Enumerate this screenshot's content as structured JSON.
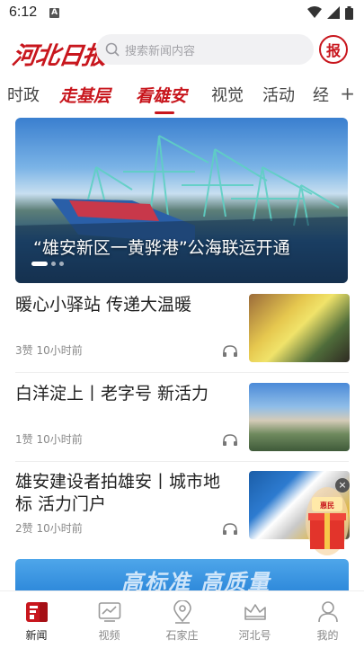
{
  "status_bar": {
    "time": "6:12",
    "notification_icon": "A"
  },
  "header": {
    "logo_text": "河北日报",
    "search_placeholder": "搜索新闻内容",
    "paper_button_label": "报"
  },
  "tabs": [
    {
      "label": "时政",
      "style": "plain"
    },
    {
      "label": "走基层",
      "style": "art"
    },
    {
      "label": "看雄安",
      "style": "art",
      "active": true
    },
    {
      "label": "视觉",
      "style": "plain"
    },
    {
      "label": "活动",
      "style": "plain"
    },
    {
      "label": "经",
      "style": "plain"
    }
  ],
  "tab_add_label": "+",
  "banner": {
    "caption": "“雄安新区一黄骅港”公海联运开通",
    "slide_count": 3,
    "active_slide": 1
  },
  "news": [
    {
      "title": "暖心小驿站 传递大温暖",
      "likes": "3赞",
      "time": "10小时前",
      "thumb_icon": "volunteer-station-photo"
    },
    {
      "title": "白洋淀上丨老字号 新活力",
      "likes": "1赞",
      "time": "10小时前",
      "thumb_icon": "cityscape-photo"
    },
    {
      "title": "雄安建设者拍雄安丨城市地标 活力门户",
      "likes": "2赞",
      "time": "10小时前",
      "thumb_icon": "construction-workers-photo"
    }
  ],
  "floating_ad": {
    "text": "雄安新区 惠民消费券",
    "close_label": "×"
  },
  "bottom_banner": {
    "text": "高标准 高质量"
  },
  "bottom_nav": [
    {
      "label": "新闻",
      "icon": "news-icon",
      "active": true
    },
    {
      "label": "视频",
      "icon": "video-icon"
    },
    {
      "label": "石家庄",
      "icon": "location-icon"
    },
    {
      "label": "河北号",
      "icon": "crown-icon"
    },
    {
      "label": "我的",
      "icon": "profile-icon"
    }
  ],
  "colors": {
    "brand_red": "#c8161d",
    "text": "#222222",
    "muted": "#888888"
  }
}
